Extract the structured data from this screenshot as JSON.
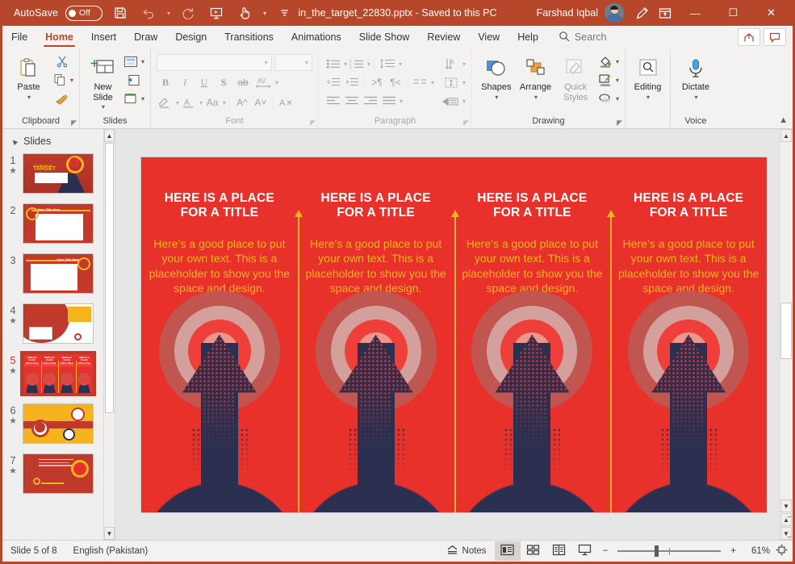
{
  "titlebar": {
    "autosave_label": "AutoSave",
    "autosave_state": "Off",
    "document_title": "in_the_target_22830.pptx  -  Saved to this PC",
    "user_name": "Farshad Iqbal",
    "icons": [
      "save-icon",
      "undo-icon",
      "redo-icon",
      "start-presentation-icon",
      "touch-mode-icon",
      "customize-qat-icon"
    ],
    "window_buttons": {
      "minimize": "—",
      "maximize": "☐",
      "close": "✕"
    }
  },
  "tabs": [
    {
      "label": "File",
      "active": false
    },
    {
      "label": "Home",
      "active": true
    },
    {
      "label": "Insert",
      "active": false
    },
    {
      "label": "Draw",
      "active": false
    },
    {
      "label": "Design",
      "active": false
    },
    {
      "label": "Transitions",
      "active": false
    },
    {
      "label": "Animations",
      "active": false
    },
    {
      "label": "Slide Show",
      "active": false
    },
    {
      "label": "Review",
      "active": false
    },
    {
      "label": "View",
      "active": false
    },
    {
      "label": "Help",
      "active": false
    }
  ],
  "search": {
    "label": "Search",
    "placeholder": "Search"
  },
  "tab_right_buttons": [
    {
      "name": "share-button",
      "label": "↱"
    },
    {
      "name": "comments-button",
      "label": "☐"
    }
  ],
  "ribbon": {
    "groups": [
      {
        "name": "clipboard",
        "label": "Clipboard",
        "big_buttons": [
          {
            "label": "Paste",
            "icon": "paste-icon"
          }
        ],
        "small_buttons": [
          {
            "label": "Cut",
            "icon": "cut-icon"
          },
          {
            "label": "Copy",
            "icon": "copy-icon"
          },
          {
            "label": "Format Painter",
            "icon": "format-painter-icon"
          }
        ],
        "has_dialog_launcher": true
      },
      {
        "name": "slides",
        "label": "Slides",
        "big_buttons": [
          {
            "label": "New Slide",
            "icon": "new-slide-icon"
          }
        ],
        "small_buttons": [
          {
            "label": "Layout",
            "icon": "layout-icon"
          },
          {
            "label": "Reset",
            "icon": "reset-icon"
          },
          {
            "label": "Section",
            "icon": "section-icon"
          }
        ],
        "has_dialog_launcher": false
      },
      {
        "name": "font",
        "label": "Font",
        "disabled": true,
        "font_name_value": "",
        "font_size_value": "",
        "small_buttons": [
          {
            "label": "Bold",
            "icon": "bold-icon"
          },
          {
            "label": "Italic",
            "icon": "italic-icon"
          },
          {
            "label": "Underline",
            "icon": "underline-icon"
          },
          {
            "label": "Text Shadow",
            "icon": "text-shadow-icon"
          },
          {
            "label": "Strikethrough",
            "icon": "strikethrough-icon"
          },
          {
            "label": "Character Spacing",
            "icon": "character-spacing-icon"
          },
          {
            "label": "Text Highlight Color",
            "icon": "text-highlight-icon"
          },
          {
            "label": "Font Color",
            "icon": "font-color-icon"
          },
          {
            "label": "Change Case",
            "icon": "change-case-icon"
          },
          {
            "label": "Increase Font Size",
            "icon": "increase-font-size-icon"
          },
          {
            "label": "Decrease Font Size",
            "icon": "decrease-font-size-icon"
          },
          {
            "label": "Clear All Formatting",
            "icon": "clear-formatting-icon"
          }
        ],
        "has_dialog_launcher": true
      },
      {
        "name": "paragraph",
        "label": "Paragraph",
        "disabled": true,
        "small_buttons": [
          {
            "label": "Bullets",
            "icon": "bullets-icon"
          },
          {
            "label": "Numbering",
            "icon": "numbering-icon"
          },
          {
            "label": "Line Spacing",
            "icon": "line-spacing-icon"
          },
          {
            "label": "Text Direction",
            "icon": "text-direction-icon"
          },
          {
            "label": "Decrease Indent",
            "icon": "decrease-indent-icon"
          },
          {
            "label": "Increase Indent",
            "icon": "increase-indent-icon"
          },
          {
            "label": "Left to Right",
            "icon": "ltr-icon"
          },
          {
            "label": "Right to Left",
            "icon": "rtl-icon"
          },
          {
            "label": "Columns",
            "icon": "columns-icon"
          },
          {
            "label": "Align Text",
            "icon": "align-text-icon"
          },
          {
            "label": "Align Left",
            "icon": "align-left-icon"
          },
          {
            "label": "Center",
            "icon": "align-center-icon"
          },
          {
            "label": "Align Right",
            "icon": "align-right-icon"
          },
          {
            "label": "Justify",
            "icon": "justify-icon"
          },
          {
            "label": "Convert to SmartArt",
            "icon": "smartart-icon"
          }
        ],
        "has_dialog_launcher": true
      },
      {
        "name": "drawing",
        "label": "Drawing",
        "big_buttons": [
          {
            "label": "Shapes",
            "icon": "shapes-icon",
            "disabled": false
          },
          {
            "label": "Arrange",
            "icon": "arrange-icon",
            "disabled": false
          },
          {
            "label": "Quick Styles",
            "icon": "quick-styles-icon",
            "disabled": true
          }
        ],
        "small_buttons": [
          {
            "label": "Shape Fill",
            "icon": "shape-fill-icon"
          },
          {
            "label": "Shape Outline",
            "icon": "shape-outline-icon"
          },
          {
            "label": "Shape Effects",
            "icon": "shape-effects-icon"
          }
        ],
        "has_dialog_launcher": true
      },
      {
        "name": "editing",
        "label": "",
        "big_buttons": [
          {
            "label": "Editing",
            "icon": "editing-search-icon"
          }
        ]
      },
      {
        "name": "voice",
        "label": "Voice",
        "big_buttons": [
          {
            "label": "Dictate",
            "icon": "dictate-microphone-icon"
          }
        ]
      }
    ],
    "collapse_icon": "collapse-ribbon-icon"
  },
  "thumbnail_pane": {
    "header": "Slides",
    "slides": [
      {
        "number": "1",
        "has_animation_star": true,
        "selected": false
      },
      {
        "number": "2",
        "has_animation_star": false,
        "selected": false
      },
      {
        "number": "3",
        "has_animation_star": false,
        "selected": false
      },
      {
        "number": "4",
        "has_animation_star": true,
        "selected": false
      },
      {
        "number": "5",
        "has_animation_star": true,
        "selected": true
      },
      {
        "number": "6",
        "has_animation_star": true,
        "selected": false
      },
      {
        "number": "7",
        "has_animation_star": true,
        "selected": false
      }
    ]
  },
  "slide": {
    "background_color": "#e8312a",
    "title_color": "#ffffff",
    "body_color": "#f5b41d",
    "arrow_color": "#2b3050",
    "columns": [
      {
        "title": "HERE IS A PLACE FOR A TITLE",
        "body": "Here’s a good place to put your own text. This is a placeholder to show you the space and design."
      },
      {
        "title": "HERE IS A PLACE FOR A TITLE",
        "body": "Here’s a good place to put your own text. This is a placeholder to show you the space and design."
      },
      {
        "title": "HERE IS A PLACE FOR A TITLE",
        "body": "Here’s a good place to put your own text. This is a placeholder to show you the space and design."
      },
      {
        "title": "HERE IS A PLACE FOR A TITLE",
        "body": "Here’s a good place to put your own text. This is a placeholder to show you the space and design."
      }
    ]
  },
  "status_bar": {
    "slide_indicator": "Slide 5 of 8",
    "language": "English (Pakistan)",
    "notes_label": "Notes",
    "view_buttons": [
      {
        "name": "normal-view-button",
        "icon": "normal-view-icon",
        "active": true
      },
      {
        "name": "slide-sorter-button",
        "icon": "slide-sorter-icon",
        "active": false
      },
      {
        "name": "reading-view-button",
        "icon": "reading-view-icon",
        "active": false
      },
      {
        "name": "slideshow-button",
        "icon": "slideshow-icon",
        "active": false
      }
    ],
    "zoom_out_label": "−",
    "zoom_in_label": "+",
    "zoom_level": "61%",
    "fit_slide_icon": "fit-to-window-icon"
  }
}
